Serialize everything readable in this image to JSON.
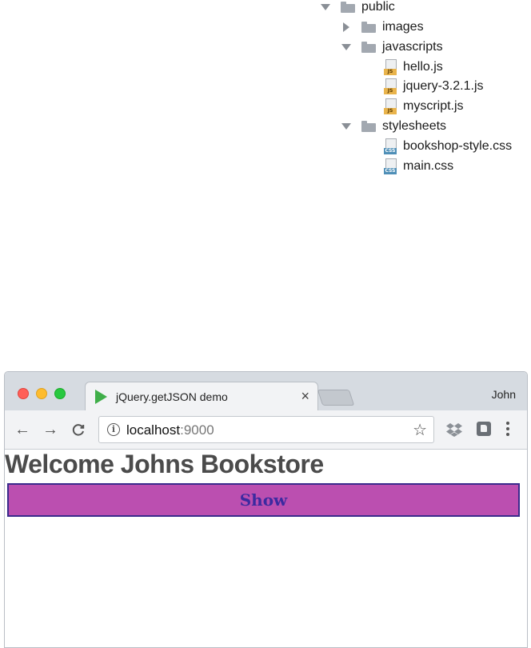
{
  "file_tree": {
    "root": "public",
    "items": [
      {
        "name": "images",
        "type": "folder",
        "expanded": false
      },
      {
        "name": "javascripts",
        "type": "folder",
        "expanded": true,
        "children": [
          "hello.js",
          "jquery-3.2.1.js",
          "myscript.js"
        ]
      },
      {
        "name": "stylesheets",
        "type": "folder",
        "expanded": true,
        "children": [
          "bookshop-style.css",
          "main.css"
        ]
      }
    ],
    "file_badges": {
      "js": "JS",
      "css": "CSS"
    },
    "colors": {
      "folder": "#a2a8b0",
      "js_badge": "#e9b44c",
      "css_badge": "#4f8fb7"
    }
  },
  "browser": {
    "tab_title": "jQuery.getJSON demo",
    "tab_icon": "play-icon",
    "close_glyph": "×",
    "profile_name": "John",
    "address_host": "localhost",
    "address_port": ":9000",
    "star_glyph": "☆",
    "nav": {
      "back": "←",
      "forward": "→",
      "reload": "C"
    }
  },
  "page": {
    "heading": "Welcome Johns Bookstore",
    "show_button": "Show",
    "colors": {
      "button_bg": "#bb4fb0",
      "button_border": "#3a2a8c",
      "button_text": "#3c2aa0",
      "heading": "#4b4b4b"
    }
  }
}
